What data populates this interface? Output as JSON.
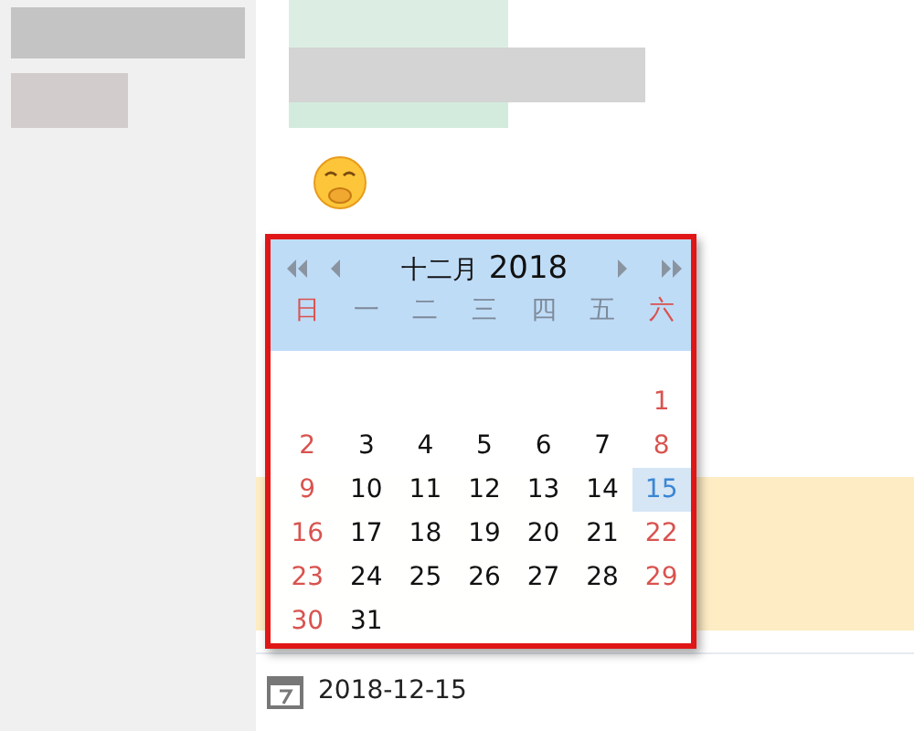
{
  "calendar": {
    "month": "十二月",
    "year": "2018",
    "weekdays": [
      {
        "label": "日",
        "weekend": true
      },
      {
        "label": "一",
        "weekend": false
      },
      {
        "label": "二",
        "weekend": false
      },
      {
        "label": "三",
        "weekend": false
      },
      {
        "label": "四",
        "weekend": false
      },
      {
        "label": "五",
        "weekend": false
      },
      {
        "label": "六",
        "weekend": true
      }
    ],
    "weeks": [
      [
        {
          "kind": "blank"
        },
        {
          "kind": "blank"
        },
        {
          "kind": "blank"
        },
        {
          "kind": "blank"
        },
        {
          "kind": "blank"
        },
        {
          "kind": "blank"
        },
        {
          "kind": "day",
          "day": "1",
          "weekend": true,
          "selected": false
        }
      ],
      [
        {
          "kind": "day",
          "day": "2",
          "weekend": true,
          "selected": false
        },
        {
          "kind": "day",
          "day": "3",
          "weekend": false,
          "selected": false
        },
        {
          "kind": "day",
          "day": "4",
          "weekend": false,
          "selected": false
        },
        {
          "kind": "day",
          "day": "5",
          "weekend": false,
          "selected": false
        },
        {
          "kind": "day",
          "day": "6",
          "weekend": false,
          "selected": false
        },
        {
          "kind": "day",
          "day": "7",
          "weekend": false,
          "selected": false
        },
        {
          "kind": "day",
          "day": "8",
          "weekend": true,
          "selected": false
        }
      ],
      [
        {
          "kind": "day",
          "day": "9",
          "weekend": true,
          "selected": false
        },
        {
          "kind": "day",
          "day": "10",
          "weekend": false,
          "selected": false
        },
        {
          "kind": "day",
          "day": "11",
          "weekend": false,
          "selected": false
        },
        {
          "kind": "day",
          "day": "12",
          "weekend": false,
          "selected": false
        },
        {
          "kind": "day",
          "day": "13",
          "weekend": false,
          "selected": false
        },
        {
          "kind": "day",
          "day": "14",
          "weekend": false,
          "selected": false
        },
        {
          "kind": "day",
          "day": "15",
          "weekend": true,
          "selected": true
        }
      ],
      [
        {
          "kind": "day",
          "day": "16",
          "weekend": true,
          "selected": false
        },
        {
          "kind": "day",
          "day": "17",
          "weekend": false,
          "selected": false
        },
        {
          "kind": "day",
          "day": "18",
          "weekend": false,
          "selected": false
        },
        {
          "kind": "day",
          "day": "19",
          "weekend": false,
          "selected": false
        },
        {
          "kind": "day",
          "day": "20",
          "weekend": false,
          "selected": false
        },
        {
          "kind": "day",
          "day": "21",
          "weekend": false,
          "selected": false
        },
        {
          "kind": "day",
          "day": "22",
          "weekend": true,
          "selected": false
        }
      ],
      [
        {
          "kind": "day",
          "day": "23",
          "weekend": true,
          "selected": false
        },
        {
          "kind": "day",
          "day": "24",
          "weekend": false,
          "selected": false
        },
        {
          "kind": "day",
          "day": "25",
          "weekend": false,
          "selected": false
        },
        {
          "kind": "day",
          "day": "26",
          "weekend": false,
          "selected": false
        },
        {
          "kind": "day",
          "day": "27",
          "weekend": false,
          "selected": false
        },
        {
          "kind": "day",
          "day": "28",
          "weekend": false,
          "selected": false
        },
        {
          "kind": "day",
          "day": "29",
          "weekend": true,
          "selected": false
        }
      ],
      [
        {
          "kind": "day",
          "day": "30",
          "weekend": true,
          "selected": false
        },
        {
          "kind": "day",
          "day": "31",
          "weekend": false,
          "selected": false
        },
        {
          "kind": "blank"
        },
        {
          "kind": "blank"
        },
        {
          "kind": "blank"
        },
        {
          "kind": "blank"
        },
        {
          "kind": "blank"
        }
      ]
    ]
  },
  "date_field": {
    "value": "2018-12-15"
  }
}
